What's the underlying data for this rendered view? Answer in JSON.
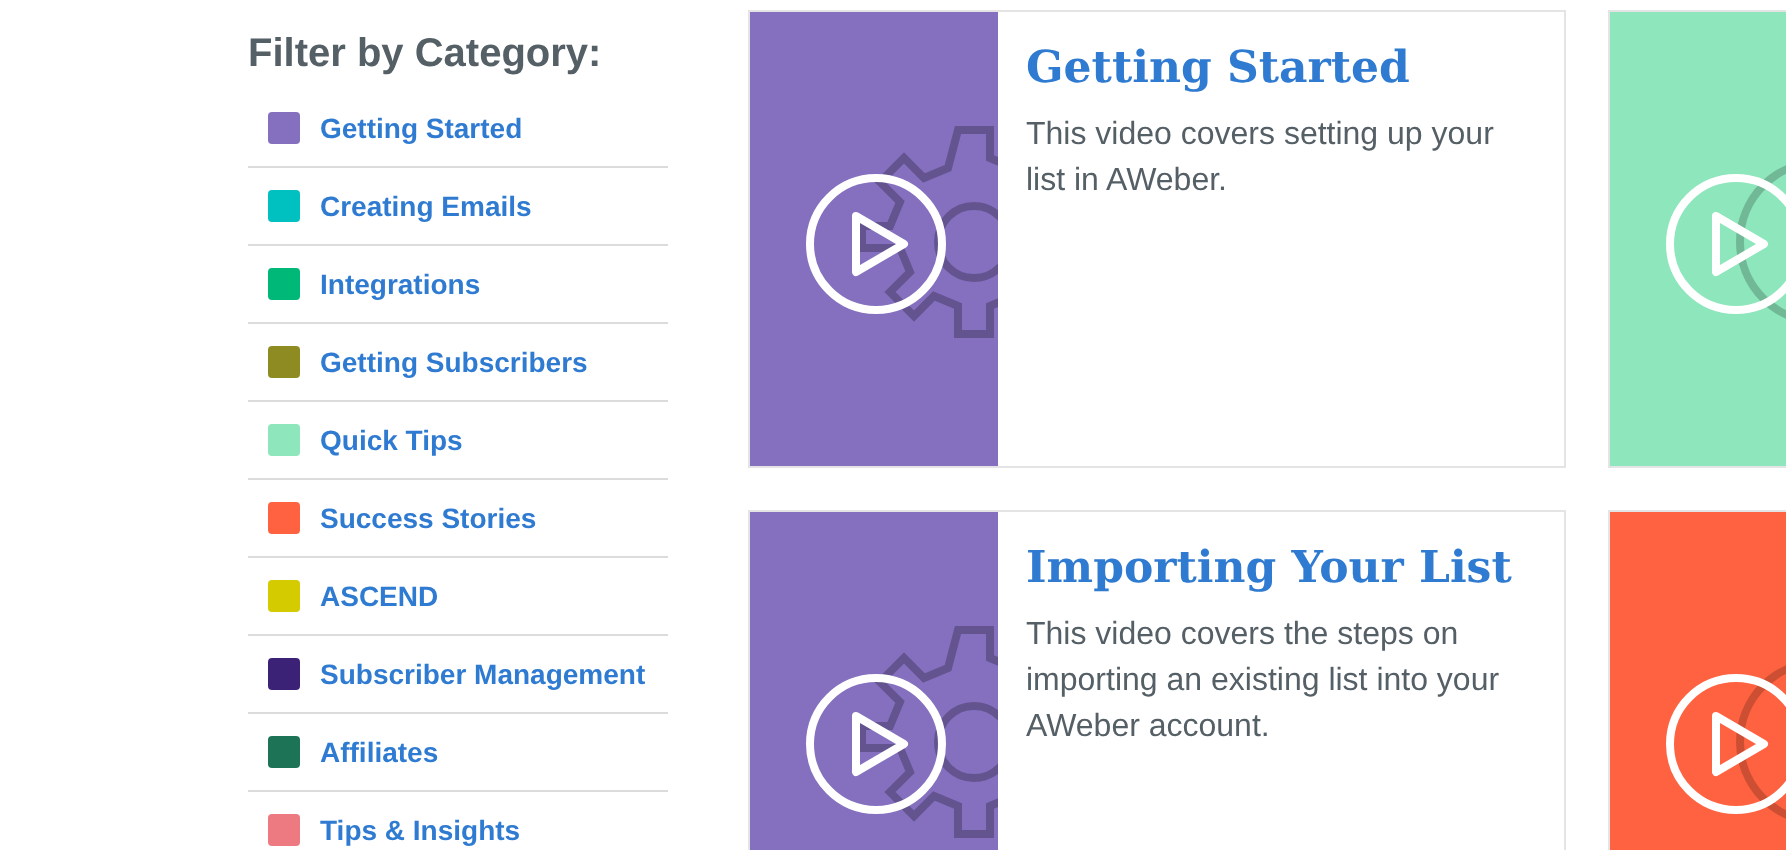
{
  "sidebar": {
    "heading": "Filter by Category:",
    "items": [
      {
        "label": "Getting Started",
        "color": "#8570c0"
      },
      {
        "label": "Creating Emails",
        "color": "#00c0c0"
      },
      {
        "label": "Integrations",
        "color": "#00b878"
      },
      {
        "label": "Getting Subscribers",
        "color": "#8e8b22"
      },
      {
        "label": "Quick Tips",
        "color": "#8ee6bc"
      },
      {
        "label": "Success Stories",
        "color": "#ff6240"
      },
      {
        "label": "ASCEND",
        "color": "#d4cb00"
      },
      {
        "label": "Subscriber Management",
        "color": "#3c2277"
      },
      {
        "label": "Affiliates",
        "color": "#1d7356"
      },
      {
        "label": "Tips & Insights",
        "color": "#ec7a80"
      }
    ]
  },
  "cards": [
    {
      "color": "#8570c0",
      "title": "Getting Started",
      "description": "This video covers setting up your list in AWeber."
    },
    {
      "color": "#8ee6bc"
    },
    {
      "color": "#8570c0",
      "title": "Importing Your List",
      "description": "This video covers the steps on importing an existing list into your AWeber account."
    },
    {
      "color": "#ff6240"
    }
  ]
}
